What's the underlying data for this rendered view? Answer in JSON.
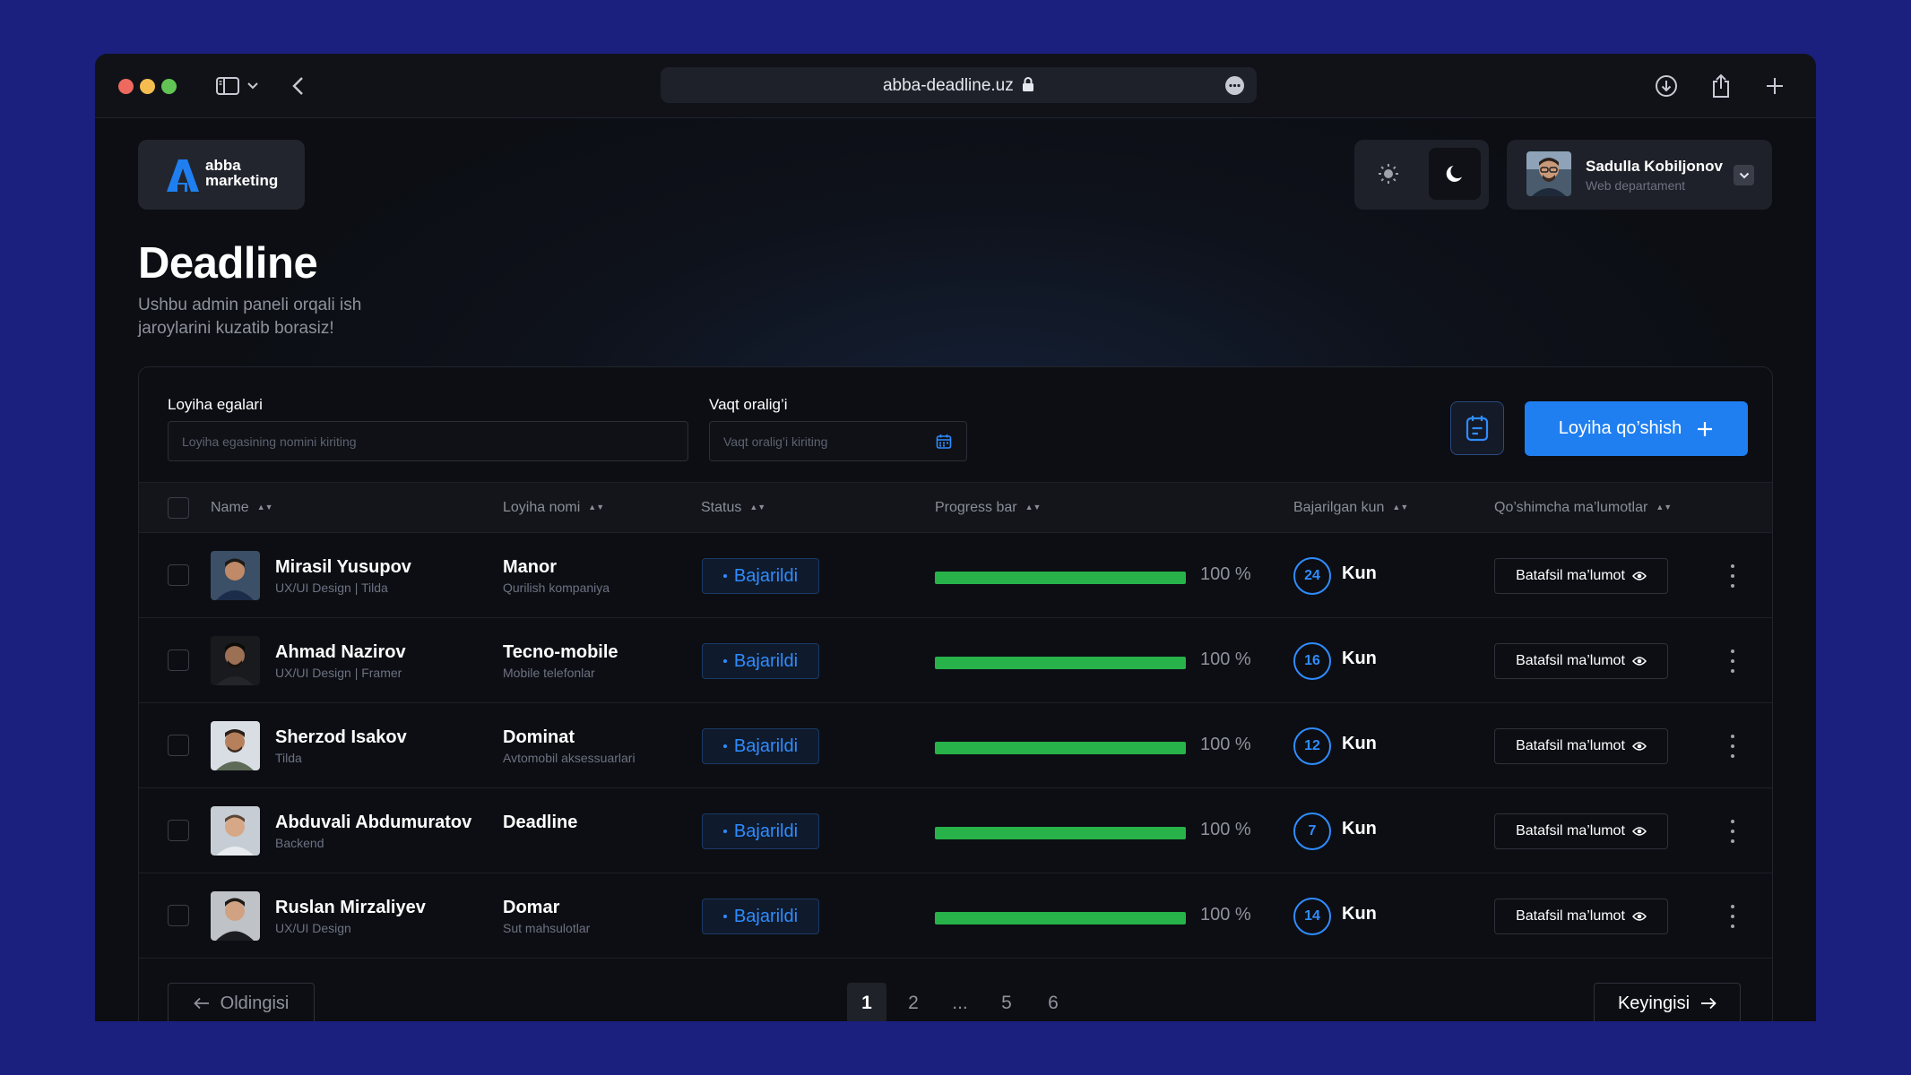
{
  "browser": {
    "url": "abba-deadline.uz"
  },
  "brand": {
    "logo_line1": "abba",
    "logo_line2": "marketing",
    "accent": "#1f7ff0"
  },
  "user": {
    "name": "Sadulla Kobiljonov",
    "department": "Web departament"
  },
  "page": {
    "title": "Deadline",
    "subtitle": "Ushbu admin paneli orqali ish jaroylarini kuzatib borasiz!"
  },
  "filters": {
    "owners_label": "Loyiha egalari",
    "owners_placeholder": "Loyiha egasining nomini kiriting",
    "range_label": "Vaqt oralig’i",
    "range_placeholder": "Vaqt oralig’i kiriting",
    "add_button": "Loyiha qo’shish"
  },
  "table": {
    "columns": {
      "name": "Name",
      "project": "Loyiha nomi",
      "status": "Status",
      "progress": "Progress bar",
      "days": "Bajarilgan kun",
      "more": "Qo’shimcha ma’lumotlar"
    },
    "rows": [
      {
        "name": "Mirasil Yusupov",
        "role": "UX/UI Design  |  Tilda",
        "project": "Manor",
        "project_sub": "Qurilish kompaniya",
        "status": "Bajarildi",
        "progress": 100,
        "progress_text": "100 %",
        "days": "24",
        "days_unit": "Kun",
        "info": "Batafsil ma’lumot"
      },
      {
        "name": "Ahmad Nazirov",
        "role": "UX/UI Design  |  Framer",
        "project": "Tecno-mobile",
        "project_sub": "Mobile telefonlar",
        "status": "Bajarildi",
        "progress": 100,
        "progress_text": "100 %",
        "days": "16",
        "days_unit": "Kun",
        "info": "Batafsil ma’lumot"
      },
      {
        "name": "Sherzod Isakov",
        "role": "Tilda",
        "project": "Dominat",
        "project_sub": "Avtomobil aksessuarlari",
        "status": "Bajarildi",
        "progress": 100,
        "progress_text": "100 %",
        "days": "12",
        "days_unit": "Kun",
        "info": "Batafsil ma’lumot"
      },
      {
        "name": "Abduvali Abdumuratov",
        "role": "Backend",
        "project": "Deadline",
        "project_sub": "",
        "status": "Bajarildi",
        "progress": 100,
        "progress_text": "100 %",
        "days": "7",
        "days_unit": "Kun",
        "info": "Batafsil ma’lumot"
      },
      {
        "name": "Ruslan Mirzaliyev",
        "role": "UX/UI Design",
        "project": "Domar",
        "project_sub": "Sut mahsulotlar",
        "status": "Bajarildi",
        "progress": 100,
        "progress_text": "100 %",
        "days": "14",
        "days_unit": "Kun",
        "info": "Batafsil ma’lumot"
      }
    ]
  },
  "pagination": {
    "prev": "Oldingisi",
    "next": "Keyingisi",
    "pages": [
      "1",
      "2",
      "...",
      "5",
      "6"
    ],
    "current": "1"
  }
}
